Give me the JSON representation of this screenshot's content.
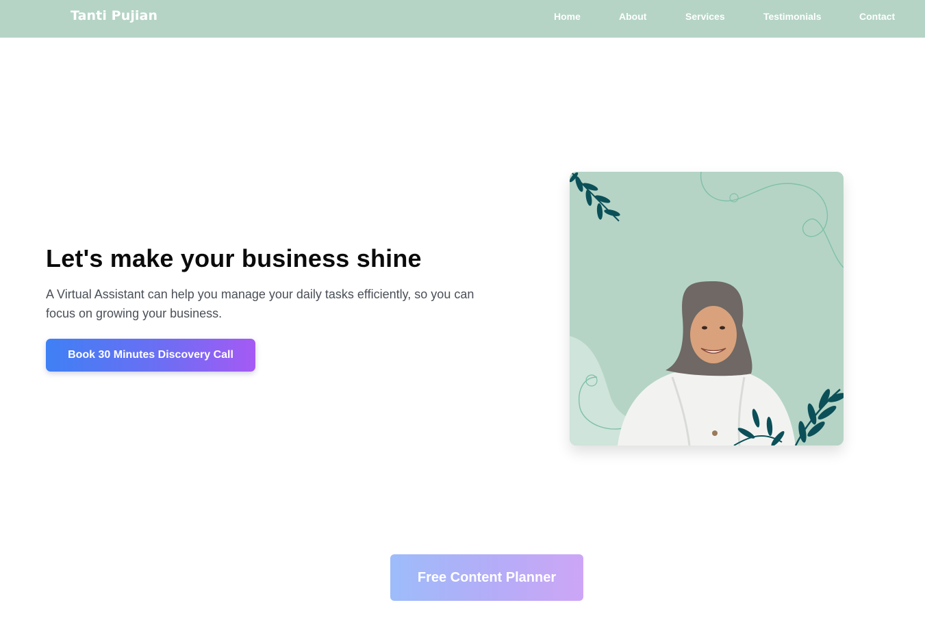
{
  "header": {
    "brand": "Tanti Pujian",
    "nav": [
      {
        "label": "Home"
      },
      {
        "label": "About"
      },
      {
        "label": "Services"
      },
      {
        "label": "Testimonials"
      },
      {
        "label": "Contact"
      }
    ]
  },
  "hero": {
    "title": "Let's make your business shine",
    "description": "A Virtual Assistant can help you manage your daily tasks efficiently, so you can focus on growing your business.",
    "cta_label": "Book 30 Minutes Discovery Call"
  },
  "promo": {
    "label": "Free Content Planner"
  },
  "colors": {
    "nav_bg": "#b5d4c6",
    "leaf": "#0b5058",
    "cta_start": "#3f80f5",
    "cta_end": "#a55af4"
  }
}
